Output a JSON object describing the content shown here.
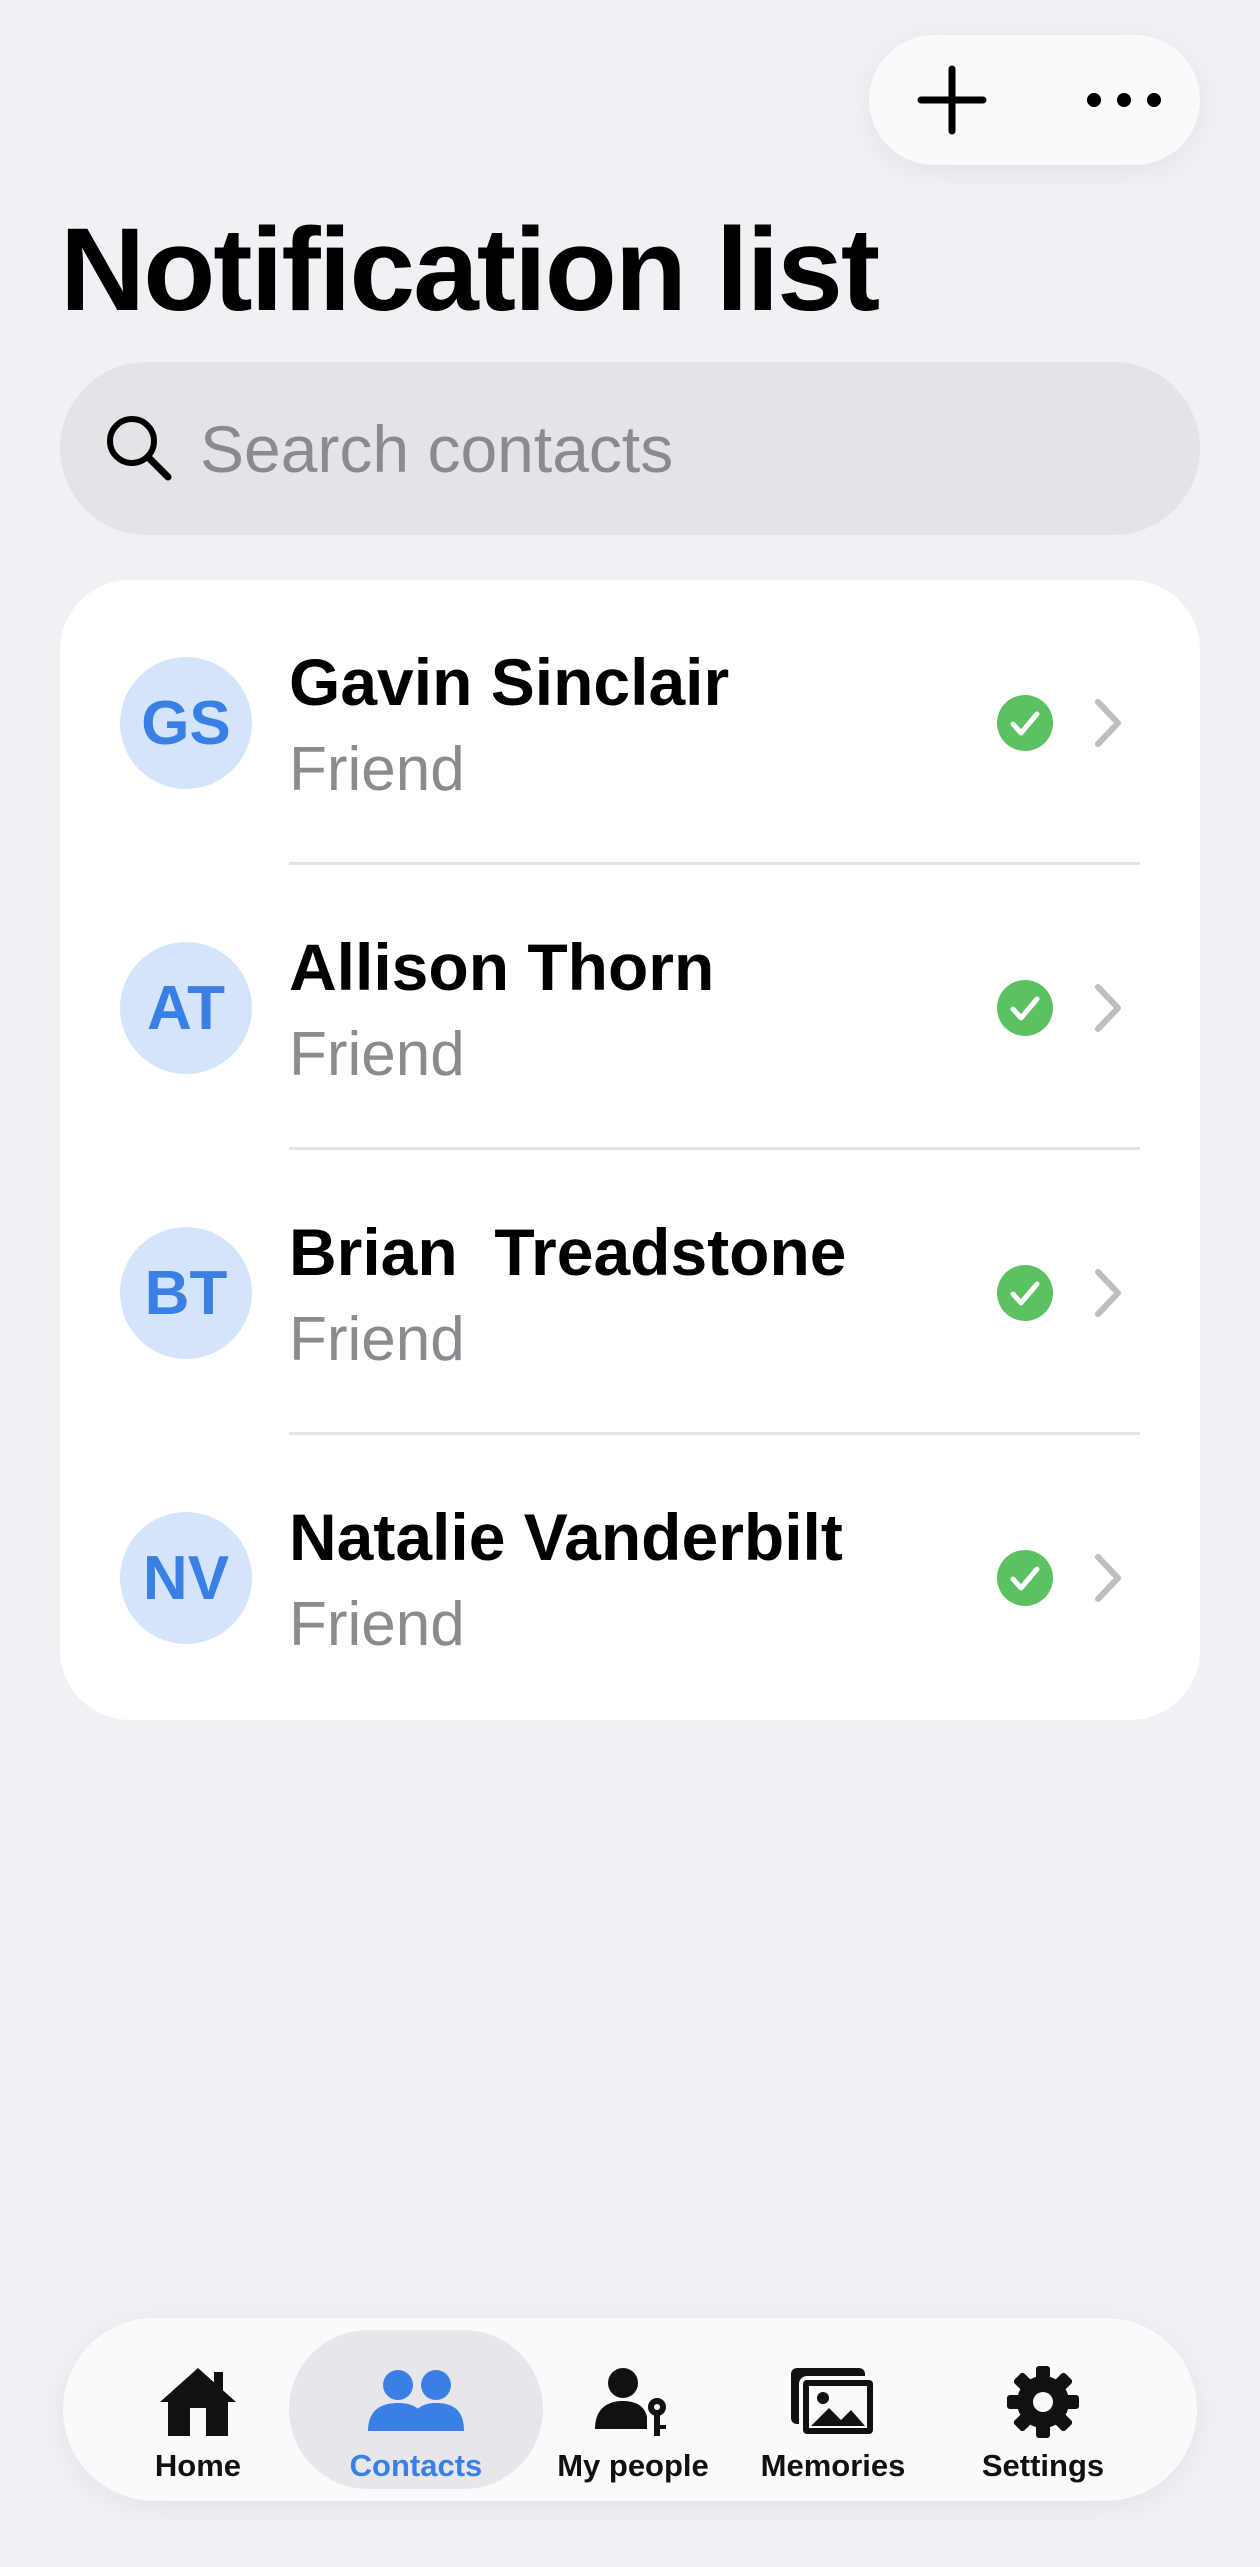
{
  "header": {
    "add_label": "+",
    "more_label": "•••",
    "title": "Notification list"
  },
  "search": {
    "placeholder": "Search contacts",
    "value": ""
  },
  "contacts": [
    {
      "initials": "GS",
      "name": "Gavin Sinclair",
      "relation": "Friend",
      "status": "check-circle-icon"
    },
    {
      "initials": "AT",
      "name": "Allison Thorn",
      "relation": "Friend",
      "status": "check-circle-icon"
    },
    {
      "initials": "BT",
      "name": "Brian  Treadstone",
      "relation": "Friend",
      "status": "check-circle-icon"
    },
    {
      "initials": "NV",
      "name": "Natalie Vanderbilt",
      "relation": "Friend",
      "status": "check-circle-icon"
    }
  ],
  "tabs": [
    {
      "label": "Home",
      "icon": "home-icon",
      "active": false
    },
    {
      "label": "Contacts",
      "icon": "contacts-icon",
      "active": true
    },
    {
      "label": "My people",
      "icon": "person-key-icon",
      "active": false
    },
    {
      "label": "Memories",
      "icon": "photos-icon",
      "active": false
    },
    {
      "label": "Settings",
      "icon": "gear-icon",
      "active": false
    }
  ],
  "colors": {
    "background": "#f1f0f5",
    "accent": "#3a80e4",
    "avatar_bg": "#d4e5fb",
    "status_green": "#5cc261",
    "secondary_text": "#8a8a8f"
  }
}
